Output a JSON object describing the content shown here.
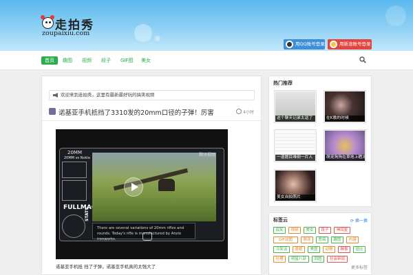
{
  "site": {
    "logo_title": "走拍秀",
    "logo_domain": "zoupaixiu.com",
    "qq_login_label": "用QQ账号登录",
    "weibo_login_label": "用新浪账号登录"
  },
  "nav": {
    "items": [
      "首页",
      "趣图",
      "视频",
      "段子",
      "GIF图",
      "美女"
    ]
  },
  "main": {
    "notice": "欢迎来到走拍秀，这里有最新最好玩的搞笑视频",
    "post": {
      "title": "诺基亚手机抵挡了3310发的20mm口径的子弹！厉害",
      "time": "4小时",
      "video_labels": {
        "caliber": "20MM",
        "versus": "20MM vs Nokia",
        "fullmag": "FULLMAG",
        "stats_tag": "STATS",
        "stats_text": "There are several variations of 20mm rifles and rounds. Today's rifle is manufactured by Anzio Ironworks.",
        "watermark": "腾讯视频"
      },
      "caption": "诺基亚手机抵 挡了子弹，诺基亚手机真的太强大了"
    }
  },
  "sidebar": {
    "hot_title": "热门推荐",
    "hot_items": [
      {
        "caption": "这个聊天记录太逗了"
      },
      {
        "caption": "在K歌的时候"
      },
      {
        "caption": "一道题目难倒一片人"
      },
      {
        "caption": "萌宠狗狗在草地上晒太阳的样子"
      },
      {
        "caption": "美女自拍照片"
      }
    ],
    "tags_title": "标签云",
    "tags_refresh": "换一换",
    "tags": [
      {
        "label": "搞笑",
        "color": "#4caf50"
      },
      {
        "label": "视频",
        "color": "#e08a2c"
      },
      {
        "label": "美女",
        "color": "#4caf50"
      },
      {
        "label": "段子",
        "color": "#d9534f"
      },
      {
        "label": "神回复",
        "color": "#d9534f"
      },
      {
        "label": "GIF动图",
        "color": "#e08a2c"
      },
      {
        "label": "萌宠",
        "color": "#e08a2c"
      },
      {
        "label": "恶搞",
        "color": "#4caf50"
      },
      {
        "label": "趣图",
        "color": "#4caf50"
      },
      {
        "label": "内涵",
        "color": "#e08a2c"
      },
      {
        "label": "冷笑话",
        "color": "#4caf50"
      },
      {
        "label": "奇葩",
        "color": "#e08a2c"
      },
      {
        "label": "美图",
        "color": "#4caf50"
      },
      {
        "label": "动物",
        "color": "#e08a2c"
      },
      {
        "label": "糗事",
        "color": "#d9534f"
      },
      {
        "label": "逗比",
        "color": "#4caf50"
      },
      {
        "label": "吐槽",
        "color": "#e08a2c"
      },
      {
        "label": "明星八卦",
        "color": "#4caf50"
      },
      {
        "label": "囧图",
        "color": "#4caf50"
      },
      {
        "label": "社会新闻",
        "color": "#d9534f"
      }
    ],
    "tags_more": "更多标签"
  }
}
